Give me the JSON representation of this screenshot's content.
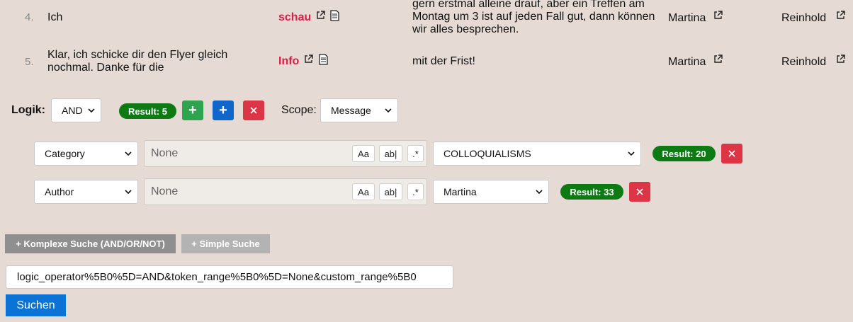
{
  "results_rows": [
    {
      "index": "4.",
      "text": "Ich",
      "keyword": "schau",
      "context_lines": [
        "gern erstmal alleine drauf, aber ein Treffen am",
        "Montag um 3 ist auf jeden Fall gut, dann können",
        "wir alles besprechen."
      ],
      "author": "Martina",
      "recipient": "Reinhold"
    },
    {
      "index": "5.",
      "text_lines": [
        "Klar, ich schicke dir den Flyer gleich",
        "nochmal. Danke für die"
      ],
      "keyword": "Info",
      "context": "mit der Frist!",
      "author": "Martina",
      "recipient": "Reinhold"
    }
  ],
  "logic": {
    "label": "Logik:",
    "operator": "AND",
    "result": "Result: 5",
    "add_label": "+",
    "add_group_label": "+",
    "scope_label": "Scope:",
    "scope_value": "Message"
  },
  "filters": [
    {
      "field": "Category",
      "text_placeholder": "None",
      "opt_case": "Aa",
      "opt_word": "ab|",
      "opt_regex": ".*",
      "value": "COLLOQUIALISMS",
      "result": "Result: 20"
    },
    {
      "field": "Author",
      "text_placeholder": "None",
      "opt_case": "Aa",
      "opt_word": "ab|",
      "opt_regex": ".*",
      "value": "Martina",
      "result": "Result: 33"
    }
  ],
  "buttons": {
    "complex_search": "+ Komplexe Suche (AND/OR/NOT)",
    "simple_search": "+ Simple Suche",
    "submit": "Suchen"
  },
  "query_string": "logic_operator%5B0%5D=AND&token_range%5B0%5D=None&custom_range%5B0",
  "colors": {
    "background": "#e5dbd4",
    "keyword": "#d6204a",
    "badge": "#0d7a14",
    "add_green": "#2ea44f",
    "add_blue": "#1166cc",
    "remove_red": "#dc3545",
    "submit_blue": "#0c73d6"
  }
}
